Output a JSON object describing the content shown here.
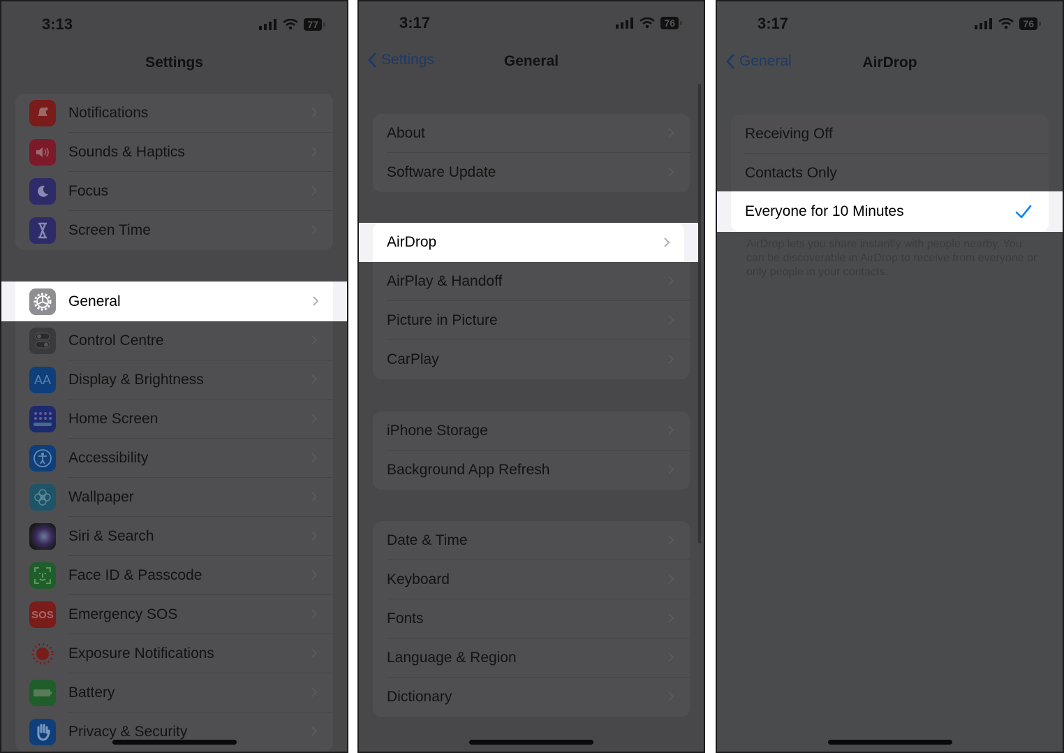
{
  "panels": [
    {
      "status": {
        "time": "3:13",
        "battery": "77"
      },
      "nav": {
        "title": "Settings"
      },
      "group1": [
        {
          "label": "Notifications",
          "icon": "bell-icon",
          "color": "#7a1c1a"
        },
        {
          "label": "Sounds & Haptics",
          "icon": "speaker-icon",
          "color": "#7c1a2a"
        },
        {
          "label": "Focus",
          "icon": "moon-icon",
          "color": "#2e2c68"
        },
        {
          "label": "Screen Time",
          "icon": "hourglass-icon",
          "color": "#2e2c68"
        }
      ],
      "selected": {
        "label": "General",
        "icon": "gear-icon",
        "color": "#8e8e93"
      },
      "group2": [
        {
          "label": "Control Centre",
          "icon": "toggles-icon",
          "color": "#3a3a3c"
        },
        {
          "label": "Display & Brightness",
          "icon": "text-size-icon",
          "color": "#0f3f7a",
          "glyph": "AA"
        },
        {
          "label": "Home Screen",
          "icon": "app-grid-icon",
          "color": "#1c2a6e"
        },
        {
          "label": "Accessibility",
          "icon": "accessibility-icon",
          "color": "#0f3f7a"
        },
        {
          "label": "Wallpaper",
          "icon": "flower-icon",
          "color": "#1f5468"
        },
        {
          "label": "Siri & Search",
          "icon": "siri-icon",
          "color": "#222"
        },
        {
          "label": "Face ID & Passcode",
          "icon": "face-id-icon",
          "color": "#1f5e2a"
        },
        {
          "label": "Emergency SOS",
          "icon": "sos-icon",
          "color": "#7a1c1a",
          "glyph": "SOS"
        },
        {
          "label": "Exposure Notifications",
          "icon": "exposure-icon",
          "color": "transparent"
        },
        {
          "label": "Battery",
          "icon": "battery-icon",
          "color": "#1f5e2a"
        },
        {
          "label": "Privacy & Security",
          "icon": "hand-icon",
          "color": "#0f3f7a"
        }
      ]
    },
    {
      "status": {
        "time": "3:17",
        "battery": "76"
      },
      "nav": {
        "title": "General",
        "back": "Settings"
      },
      "group1": [
        {
          "label": "About"
        },
        {
          "label": "Software Update"
        }
      ],
      "selected": {
        "label": "AirDrop"
      },
      "group2": [
        {
          "label": "AirPlay & Handoff"
        },
        {
          "label": "Picture in Picture"
        },
        {
          "label": "CarPlay"
        }
      ],
      "group3": [
        {
          "label": "iPhone Storage"
        },
        {
          "label": "Background App Refresh"
        }
      ],
      "group4": [
        {
          "label": "Date & Time"
        },
        {
          "label": "Keyboard"
        },
        {
          "label": "Fonts"
        },
        {
          "label": "Language & Region"
        },
        {
          "label": "Dictionary"
        }
      ]
    },
    {
      "status": {
        "time": "3:17",
        "battery": "76"
      },
      "nav": {
        "title": "AirDrop",
        "back": "General"
      },
      "options": [
        {
          "label": "Receiving Off"
        },
        {
          "label": "Contacts Only"
        }
      ],
      "selected": {
        "label": "Everyone for 10 Minutes",
        "checked": true
      },
      "footer": "AirDrop lets you share instantly with people nearby. You can be discoverable in AirDrop to receive from everyone or only people in your contacts."
    }
  ],
  "colors": {
    "accent": "#0a84ff",
    "dim_accent": "#1d3a66"
  }
}
